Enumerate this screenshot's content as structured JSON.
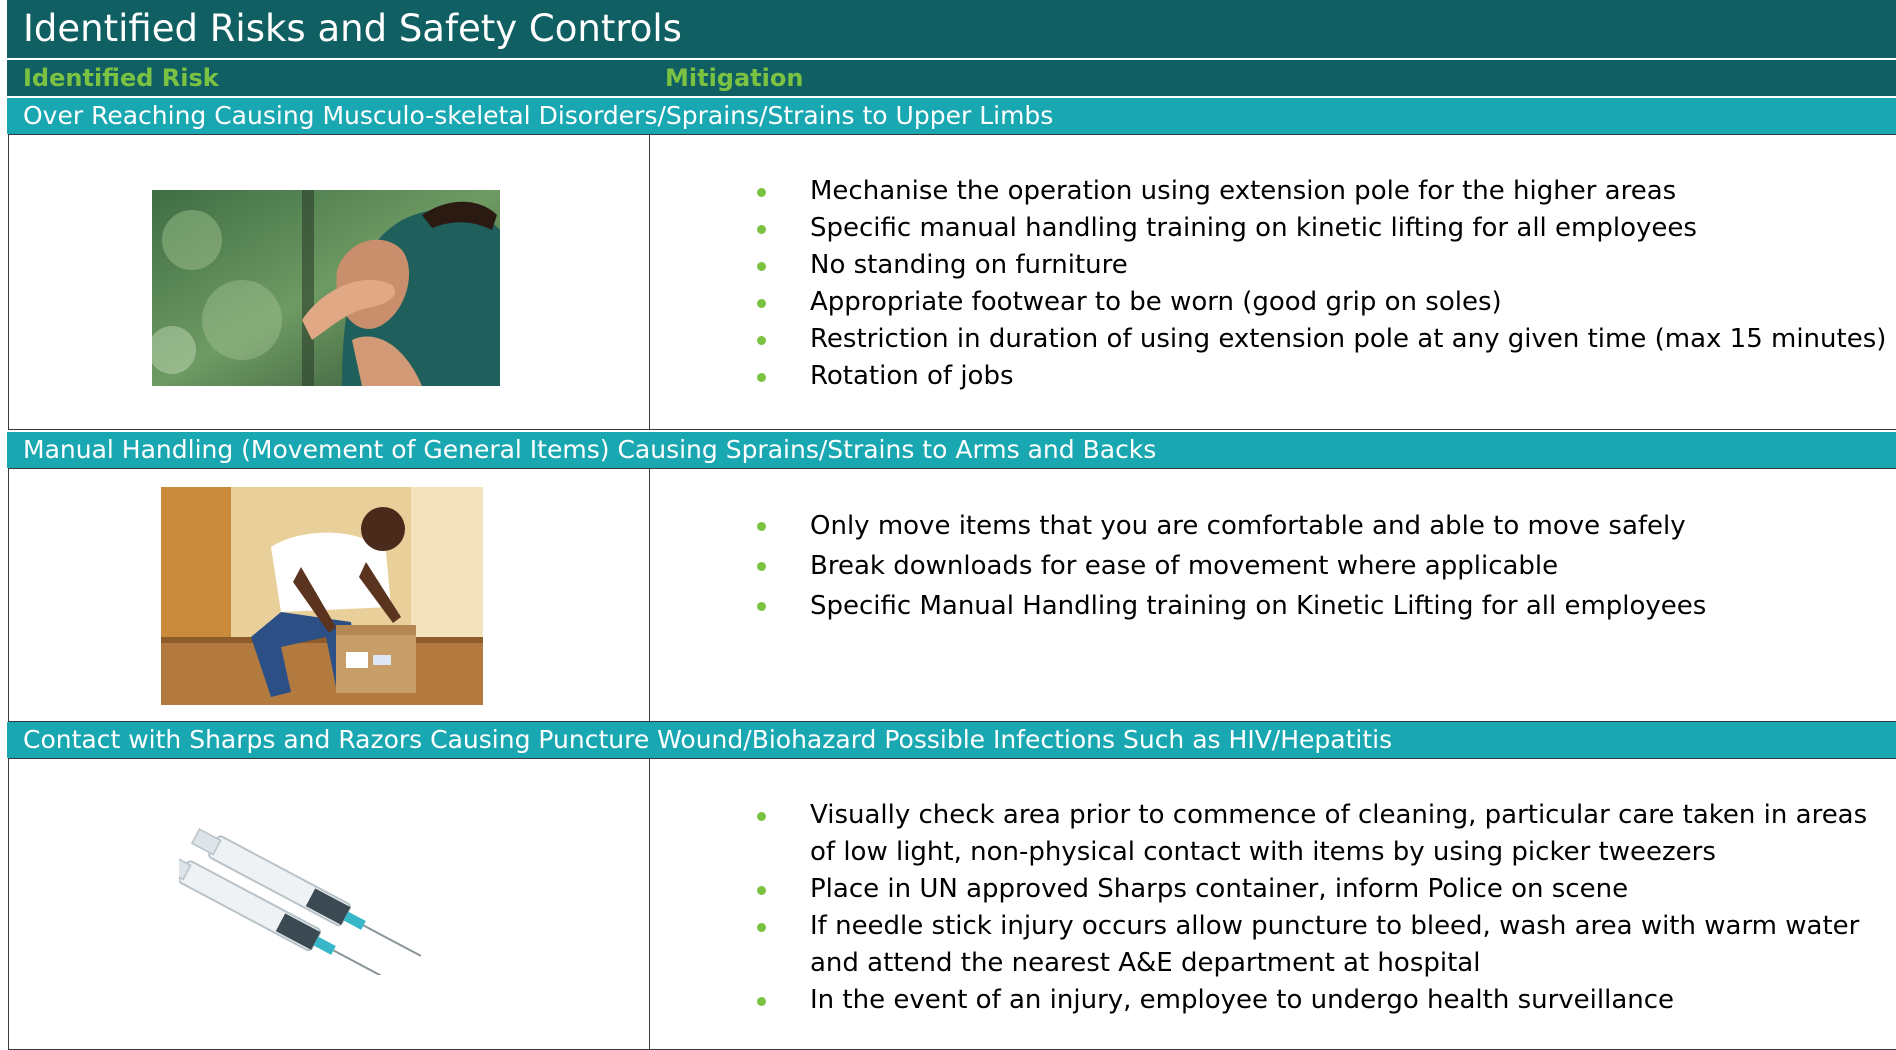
{
  "title": "Identified Risks and Safety Controls",
  "headers": {
    "risk": "Identified Risk",
    "mitigation": "Mitigation"
  },
  "colors": {
    "dark_teal": "#0f5f63",
    "light_teal": "#19a7b2",
    "accent_green": "#7cc242"
  },
  "risks": [
    {
      "title": "Over Reaching Causing Musculo-skeletal Disorders/Sprains/Strains to Upper Limbs",
      "image": "shoulder-pain-photo",
      "mitigations": [
        "Mechanise the operation using extension pole for the higher areas",
        "Specific manual handling training on kinetic lifting for all employees",
        "No standing on furniture",
        "Appropriate footwear to be worn (good grip on soles)",
        "Restriction in duration of using extension pole at any given time (max 15 minutes)",
        "Rotation of jobs"
      ]
    },
    {
      "title": "Manual Handling (Movement of General Items) Causing Sprains/Strains to Arms and Backs",
      "image": "lifting-box-photo",
      "mitigations": [
        "Only move items that you are comfortable and able to move safely",
        "Break downloads for ease of movement where applicable",
        "Specific Manual Handling training on Kinetic Lifting for all employees"
      ]
    },
    {
      "title": "Contact with Sharps and Razors Causing Puncture Wound/Biohazard Possible Infections Such as HIV/Hepatitis",
      "image": "syringes-photo",
      "mitigations": [
        "Visually check area prior to commence of cleaning, particular care taken in areas of low light, non-physical contact with items by using picker tweezers",
        "Place in UN approved Sharps container, inform Police on scene",
        "If needle stick injury occurs allow puncture to bleed, wash area with warm water and attend the nearest A&E department at hospital",
        "In the event of an injury, employee to undergo health surveillance"
      ]
    }
  ]
}
